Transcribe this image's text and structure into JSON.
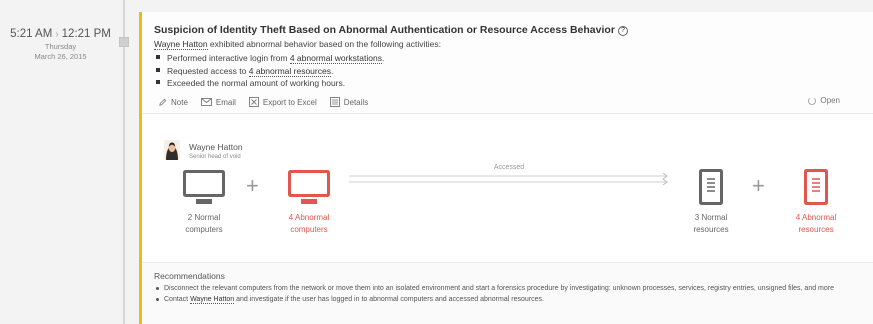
{
  "timeline": {
    "start_time": "5:21 AM",
    "end_time": "12:21 PM",
    "day": "Thursday",
    "date": "March 26, 2015"
  },
  "alert": {
    "title": "Suspicion of Identity Theft Based on Abnormal Authentication or Resource Access Behavior",
    "help_icon": "?",
    "accent_color": "#f2b71b",
    "subject_name": "Wayne Hatton",
    "subject_suffix": "exhibited abnormal behavior based on the following activities:",
    "activities": [
      {
        "prefix": "Performed interactive login from ",
        "link": "4 abnormal workstations",
        "suffix": "."
      },
      {
        "prefix": "Requested access to ",
        "link": "4 abnormal resources",
        "suffix": "."
      },
      {
        "prefix": "Exceeded the normal amount of working hours.",
        "link": "",
        "suffix": ""
      }
    ],
    "actions": [
      {
        "label": "Note",
        "icon": "pencil-icon"
      },
      {
        "label": "Email",
        "icon": "envelope-icon"
      },
      {
        "label": "Export to Excel",
        "icon": "excel-icon"
      },
      {
        "label": "Details",
        "icon": "details-icon"
      }
    ],
    "status": "Open"
  },
  "diagram": {
    "user_name": "Wayne Hatton",
    "user_role": "Senior head of void",
    "accessed_label": "Accessed",
    "normal_color": "#666666",
    "abnormal_color": "#e2564f",
    "groups": [
      {
        "line1": "2 Normal",
        "line2": "computers",
        "kind": "normal",
        "icon": "computer-icon"
      },
      {
        "line1": "4 Abnormal",
        "line2": "computers",
        "kind": "abnormal",
        "icon": "computer-icon"
      },
      {
        "line1": "3 Normal",
        "line2": "resources",
        "kind": "normal",
        "icon": "server-icon"
      },
      {
        "line1": "4 Abnormal",
        "line2": "resources",
        "kind": "abnormal",
        "icon": "server-icon"
      }
    ]
  },
  "recommendations": {
    "title": "Recommendations",
    "items": [
      {
        "text": "Disconnect the relevant computers from the network or move them into an isolated environment and start a forensics procedure by investigating: unknown processes, services, registry entries, unsigned files, and more"
      },
      {
        "prefix": "Contact ",
        "link": "Wayne Hatton",
        "suffix": " and investigate if the user has logged in to abnormal computers and accessed abnormal resources."
      }
    ]
  }
}
